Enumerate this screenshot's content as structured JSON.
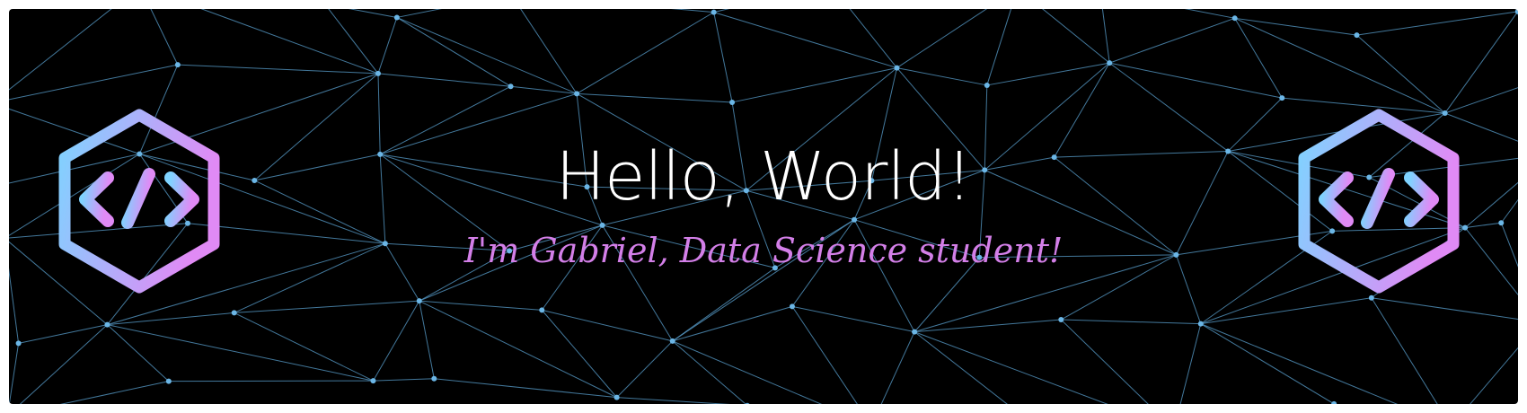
{
  "headline": "Hello, World!",
  "subline": "I'm Gabriel, Data Science student!",
  "colors": {
    "background": "#000000",
    "mesh_line": "#5aa0cf",
    "mesh_node": "#6bb6e6",
    "headline": "#ffffff",
    "subline": "#d37fe8",
    "logo_gradient_start": "#7fd3ff",
    "logo_gradient_end": "#e08af5"
  },
  "icons": {
    "left_logo": "code-hexagon-icon",
    "right_logo": "code-hexagon-icon"
  }
}
